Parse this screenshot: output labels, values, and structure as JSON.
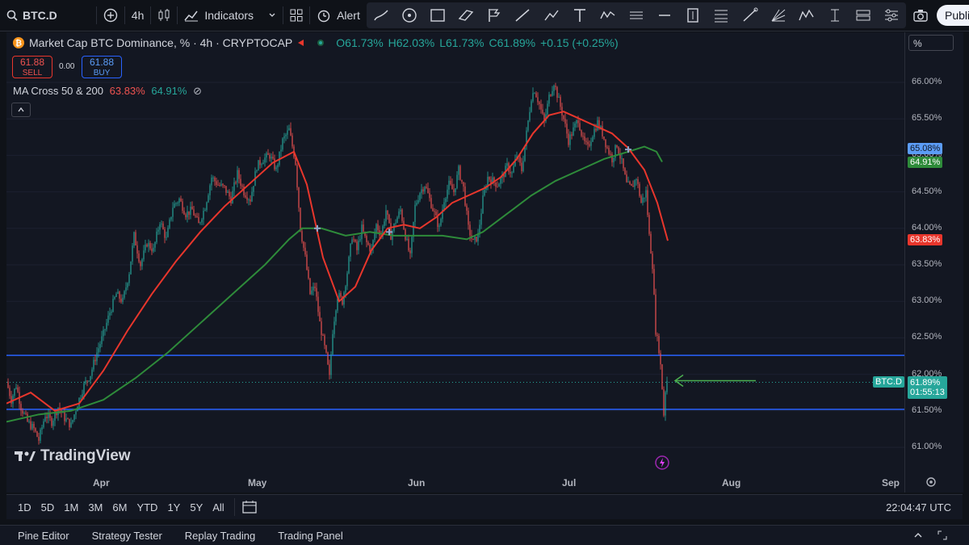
{
  "toolbar": {
    "symbol": "BTC.D",
    "interval": "4h",
    "indicators": "Indicators",
    "alert": "Alert",
    "publish": "Publi"
  },
  "legend": {
    "title": "Market Cap BTC Dominance, % · 4h · CRYPTOCAP",
    "open": "O61.73%",
    "high": "H62.03%",
    "low": "L61.73%",
    "close": "C61.89%",
    "change": "+0.15 (+0.25%)",
    "sell_price": "61.88",
    "sell_label": "SELL",
    "spread": "0.00",
    "buy_price": "61.88",
    "buy_label": "BUY",
    "ma_name": "MA Cross 50 & 200",
    "ma_fast": "63.83%",
    "ma_slow": "64.91%"
  },
  "price_axis": {
    "unit": "%",
    "labels": [
      "66.00%",
      "65.50%",
      "65.00%",
      "64.50%",
      "64.00%",
      "63.50%",
      "63.00%",
      "62.50%",
      "62.00%",
      "61.50%",
      "61.00%"
    ],
    "tag_slow_upper": "65.08%",
    "tag_slow": "64.91%",
    "tag_fast": "63.83%",
    "tag_symbol": "BTC.D",
    "tag_price": "61.89%",
    "tag_countdown": "01:55:13"
  },
  "time_axis": {
    "labels": [
      "Apr",
      "May",
      "Jun",
      "Jul",
      "Aug",
      "Sep"
    ]
  },
  "watermark": "TradingView",
  "timeframes": [
    "1D",
    "5D",
    "1M",
    "3M",
    "6M",
    "YTD",
    "1Y",
    "5Y",
    "All"
  ],
  "clock": "22:04:47 UTC",
  "panels": [
    "Pine Editor",
    "Strategy Tester",
    "Replay Trading",
    "Trading Panel"
  ],
  "colors": {
    "up": "#26a69a",
    "down": "#ef5350",
    "ma_fast": "#e8362c",
    "ma_slow": "#2e8b3a",
    "hline": "#2962ff",
    "arrow": "#4caf50"
  },
  "chart_data": {
    "type": "line",
    "ylim": [
      60.9,
      66.2
    ],
    "x_ticks": [
      "Apr",
      "May",
      "Jun",
      "Jul",
      "Aug",
      "Sep"
    ],
    "horizontal_lines": [
      62.26,
      61.52
    ],
    "price_path": [
      [
        0,
        61.9
      ],
      [
        6,
        61.65
      ],
      [
        12,
        61.85
      ],
      [
        18,
        61.55
      ],
      [
        26,
        61.35
      ],
      [
        34,
        61.25
      ],
      [
        40,
        61.1
      ],
      [
        48,
        61.45
      ],
      [
        56,
        61.35
      ],
      [
        64,
        61.55
      ],
      [
        72,
        61.4
      ],
      [
        80,
        61.3
      ],
      [
        88,
        61.6
      ],
      [
        96,
        61.85
      ],
      [
        104,
        62.0
      ],
      [
        112,
        62.3
      ],
      [
        120,
        62.55
      ],
      [
        128,
        62.85
      ],
      [
        136,
        63.1
      ],
      [
        144,
        63.0
      ],
      [
        152,
        63.4
      ],
      [
        158,
        63.9
      ],
      [
        166,
        63.5
      ],
      [
        174,
        63.8
      ],
      [
        182,
        63.7
      ],
      [
        190,
        64.1
      ],
      [
        198,
        63.85
      ],
      [
        206,
        64.3
      ],
      [
        214,
        64.4
      ],
      [
        222,
        64.2
      ],
      [
        230,
        64.25
      ],
      [
        238,
        64.05
      ],
      [
        246,
        64.3
      ],
      [
        254,
        64.7
      ],
      [
        262,
        64.6
      ],
      [
        270,
        64.55
      ],
      [
        278,
        64.4
      ],
      [
        286,
        64.75
      ],
      [
        294,
        64.5
      ],
      [
        302,
        64.4
      ],
      [
        310,
        64.85
      ],
      [
        318,
        64.95
      ],
      [
        326,
        65.0
      ],
      [
        334,
        64.8
      ],
      [
        342,
        65.2
      ],
      [
        350,
        65.35
      ],
      [
        358,
        64.9
      ],
      [
        364,
        64.0
      ],
      [
        370,
        63.6
      ],
      [
        376,
        63.1
      ],
      [
        382,
        63.2
      ],
      [
        388,
        62.7
      ],
      [
        396,
        62.25
      ],
      [
        400,
        61.95
      ],
      [
        404,
        62.6
      ],
      [
        410,
        63.1
      ],
      [
        416,
        63.0
      ],
      [
        422,
        63.4
      ],
      [
        428,
        63.9
      ],
      [
        434,
        63.7
      ],
      [
        440,
        64.0
      ],
      [
        446,
        63.8
      ],
      [
        452,
        63.7
      ],
      [
        458,
        64.05
      ],
      [
        464,
        63.9
      ],
      [
        470,
        64.25
      ],
      [
        476,
        63.9
      ],
      [
        482,
        64.1
      ],
      [
        488,
        64.25
      ],
      [
        494,
        63.9
      ],
      [
        500,
        63.6
      ],
      [
        506,
        64.3
      ],
      [
        512,
        64.5
      ],
      [
        518,
        64.6
      ],
      [
        524,
        64.4
      ],
      [
        530,
        64.2
      ],
      [
        536,
        64.0
      ],
      [
        542,
        64.4
      ],
      [
        548,
        64.6
      ],
      [
        554,
        64.5
      ],
      [
        560,
        64.8
      ],
      [
        566,
        64.55
      ],
      [
        572,
        64.0
      ],
      [
        578,
        63.8
      ],
      [
        584,
        63.9
      ],
      [
        590,
        64.4
      ],
      [
        596,
        64.7
      ],
      [
        602,
        64.65
      ],
      [
        608,
        64.6
      ],
      [
        614,
        64.7
      ],
      [
        620,
        64.85
      ],
      [
        626,
        64.75
      ],
      [
        632,
        65.0
      ],
      [
        638,
        64.8
      ],
      [
        644,
        65.3
      ],
      [
        650,
        65.8
      ],
      [
        654,
        65.9
      ],
      [
        660,
        65.7
      ],
      [
        666,
        65.45
      ],
      [
        672,
        65.8
      ],
      [
        678,
        66.0
      ],
      [
        684,
        65.75
      ],
      [
        690,
        65.5
      ],
      [
        696,
        65.2
      ],
      [
        702,
        65.35
      ],
      [
        708,
        65.5
      ],
      [
        714,
        65.2
      ],
      [
        720,
        65.1
      ],
      [
        726,
        65.3
      ],
      [
        732,
        65.45
      ],
      [
        738,
        65.3
      ],
      [
        744,
        65.1
      ],
      [
        750,
        64.95
      ],
      [
        756,
        65.15
      ],
      [
        762,
        64.9
      ],
      [
        768,
        64.6
      ],
      [
        774,
        64.55
      ],
      [
        780,
        64.7
      ],
      [
        786,
        64.35
      ],
      [
        792,
        64.5
      ],
      [
        796,
        63.9
      ],
      [
        800,
        63.5
      ],
      [
        804,
        62.6
      ],
      [
        808,
        62.35
      ],
      [
        811,
        62.0
      ],
      [
        814,
        61.45
      ],
      [
        817,
        61.95
      ],
      [
        819,
        61.89
      ]
    ],
    "ma_fast_path": [
      [
        0,
        61.6
      ],
      [
        30,
        61.75
      ],
      [
        60,
        61.5
      ],
      [
        90,
        61.6
      ],
      [
        120,
        62.05
      ],
      [
        150,
        62.6
      ],
      [
        180,
        63.1
      ],
      [
        210,
        63.55
      ],
      [
        240,
        63.95
      ],
      [
        270,
        64.3
      ],
      [
        300,
        64.6
      ],
      [
        330,
        64.9
      ],
      [
        356,
        65.05
      ],
      [
        372,
        64.6
      ],
      [
        392,
        63.6
      ],
      [
        412,
        63.0
      ],
      [
        432,
        63.2
      ],
      [
        452,
        63.7
      ],
      [
        472,
        64.0
      ],
      [
        492,
        64.05
      ],
      [
        512,
        64.0
      ],
      [
        532,
        64.15
      ],
      [
        552,
        64.35
      ],
      [
        572,
        64.45
      ],
      [
        592,
        64.55
      ],
      [
        612,
        64.7
      ],
      [
        632,
        64.95
      ],
      [
        652,
        65.3
      ],
      [
        672,
        65.55
      ],
      [
        690,
        65.6
      ],
      [
        710,
        65.5
      ],
      [
        730,
        65.4
      ],
      [
        750,
        65.3
      ],
      [
        770,
        65.1
      ],
      [
        790,
        64.8
      ],
      [
        806,
        64.35
      ],
      [
        819,
        63.83
      ]
    ],
    "ma_slow_path": [
      [
        0,
        61.35
      ],
      [
        40,
        61.45
      ],
      [
        80,
        61.5
      ],
      [
        120,
        61.65
      ],
      [
        160,
        61.95
      ],
      [
        200,
        62.3
      ],
      [
        240,
        62.7
      ],
      [
        280,
        63.1
      ],
      [
        320,
        63.5
      ],
      [
        350,
        63.85
      ],
      [
        366,
        64.0
      ],
      [
        390,
        64.0
      ],
      [
        420,
        63.9
      ],
      [
        450,
        63.95
      ],
      [
        480,
        63.9
      ],
      [
        510,
        63.9
      ],
      [
        540,
        63.9
      ],
      [
        570,
        63.85
      ],
      [
        590,
        63.95
      ],
      [
        620,
        64.2
      ],
      [
        650,
        64.45
      ],
      [
        680,
        64.65
      ],
      [
        710,
        64.8
      ],
      [
        740,
        64.95
      ],
      [
        770,
        65.05
      ],
      [
        790,
        65.12
      ],
      [
        805,
        65.05
      ],
      [
        812,
        64.91
      ]
    ]
  }
}
